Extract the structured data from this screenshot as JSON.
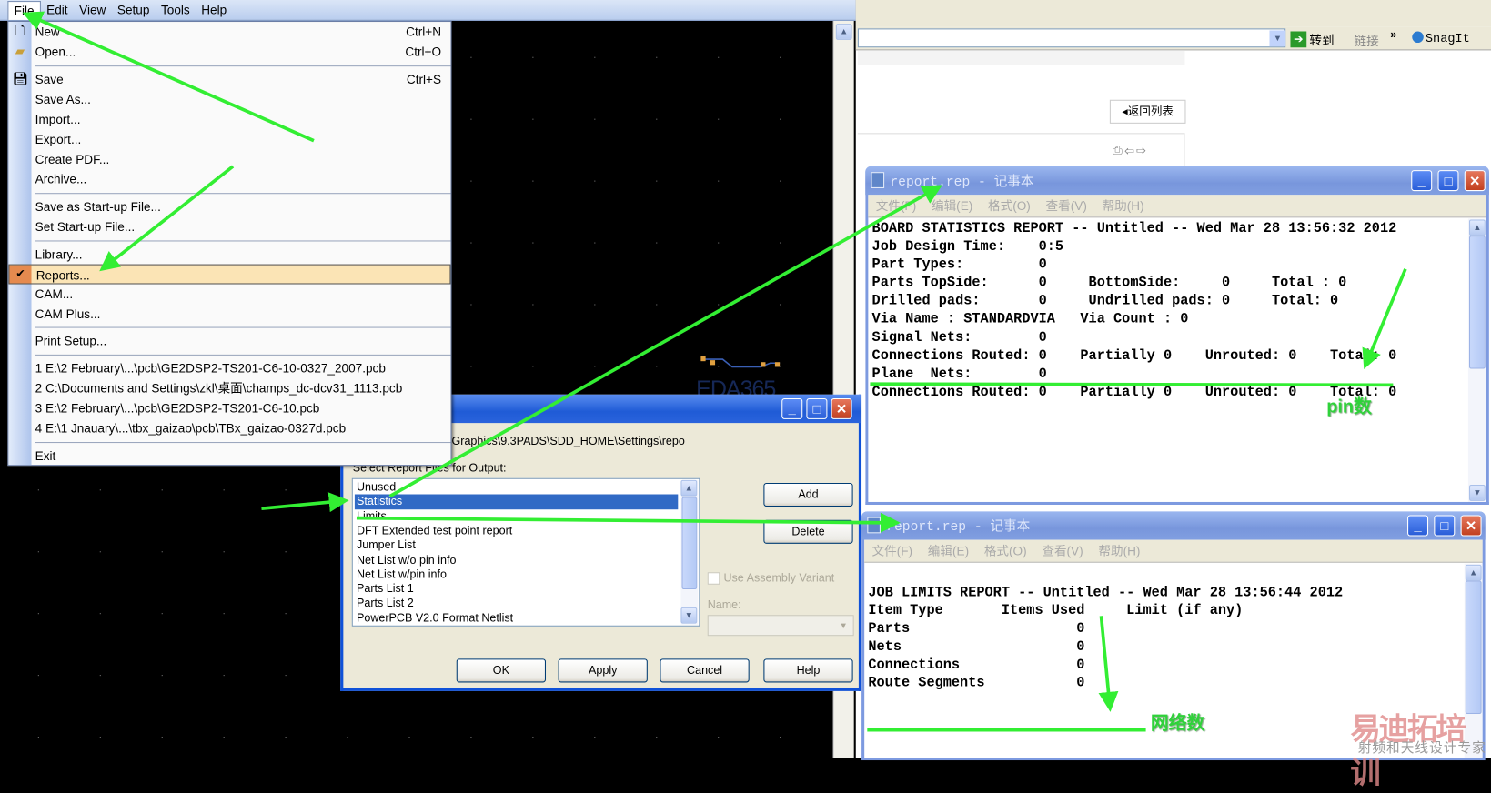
{
  "pads": {
    "menubar": [
      "File",
      "Edit",
      "View",
      "Setup",
      "Tools",
      "Help"
    ],
    "file_menu": {
      "items": [
        {
          "label": "New",
          "shortcut": "Ctrl+N",
          "icon": "new-file-icon"
        },
        {
          "label": "Open...",
          "shortcut": "Ctrl+O",
          "icon": "open-folder-icon"
        },
        {
          "label": "Save",
          "shortcut": "Ctrl+S",
          "icon": "save-disk-icon"
        },
        {
          "label": "Save As..."
        },
        {
          "label": "Import..."
        },
        {
          "label": "Export..."
        },
        {
          "label": "Create PDF..."
        },
        {
          "label": "Archive..."
        },
        {
          "label": "Save as Start-up File..."
        },
        {
          "label": "Set Start-up File..."
        },
        {
          "label": "Library..."
        },
        {
          "label": "Reports...",
          "highlighted": true,
          "icon": "checkmark-icon"
        },
        {
          "label": "CAM..."
        },
        {
          "label": "CAM Plus..."
        },
        {
          "label": "Print Setup..."
        },
        {
          "label": "1 E:\\2 February\\...\\pcb\\GE2DSP2-TS201-C6-10-0327_2007.pcb"
        },
        {
          "label": "2 C:\\Documents and Settings\\zkl\\桌面\\champs_dc-dcv31_1113.pcb"
        },
        {
          "label": "3 E:\\2 February\\...\\pcb\\GE2DSP2-TS201-C6-10.pcb"
        },
        {
          "label": "4 E:\\1 Jnauary\\...\\tbx_gaizao\\pcb\\TBx_gaizao-0327d.pcb"
        },
        {
          "label": "Exit"
        }
      ]
    },
    "watermark": "EDA365"
  },
  "dialog": {
    "path": "Graphics\\9.3PADS\\SDD_HOME\\Settings\\repo",
    "select_label": "Select Report Files for Output:",
    "list": [
      "Unused",
      "Statistics",
      "Limits",
      "DFT Extended test point report",
      "Jumper List",
      "Net List w/o pin info",
      "Net List w/pin info",
      "Parts List 1",
      "Parts List 2",
      "PowerPCB V2.0 Format Netlist"
    ],
    "selected_index": 1,
    "add": "Add",
    "delete": "Delete",
    "use_assembly_variant": "Use Assembly Variant",
    "name_label": "Name:",
    "ok": "OK",
    "apply": "Apply",
    "cancel": "Cancel",
    "help": "Help"
  },
  "browser": {
    "goto": "转到",
    "links": "链接",
    "chevron": "»",
    "snagit": "SnagIt",
    "back_to_list": "返回列表"
  },
  "notepad1": {
    "title": "report.rep - 记事本",
    "menu": [
      "文件(F)",
      "编辑(E)",
      "格式(O)",
      "查看(V)",
      "帮助(H)"
    ],
    "lines": [
      "BOARD STATISTICS REPORT -- Untitled -- Wed Mar 28 13:56:32 2012",
      "",
      "",
      "Job Design Time:    0:5",
      "",
      "Part Types:         0",
      "Parts TopSide:      0     BottomSide:     0     Total : 0",
      "Drilled pads:       0     Undrilled pads: 0     Total: 0",
      "Via Name : STANDARDVIA   Via Count : 0",
      "Signal Nets:        0",
      "Connections Routed: 0    Partially 0    Unrouted: 0    Total: 0",
      "",
      "Plane  Nets:        0",
      "Connections Routed: 0    Partially 0    Unrouted: 0    Total: 0"
    ]
  },
  "notepad2": {
    "title": "report.rep - 记事本",
    "menu": [
      "文件(F)",
      "编辑(E)",
      "格式(O)",
      "查看(V)",
      "帮助(H)"
    ],
    "lines": [
      "JOB LIMITS REPORT -- Untitled -- Wed Mar 28 13:56:44 2012",
      "",
      "",
      "Item Type       Items Used     Limit (if any)",
      "",
      "Parts                    0",
      "",
      "Nets                     0",
      "Connections              0",
      "Route Segments           0"
    ]
  },
  "annotations": {
    "pin_count": "pin数",
    "net_count": "网络数",
    "arrow_color": "#33ee33"
  },
  "watermark": {
    "brand": "易迪拓培训",
    "tagline": "射频和天线设计专家"
  }
}
